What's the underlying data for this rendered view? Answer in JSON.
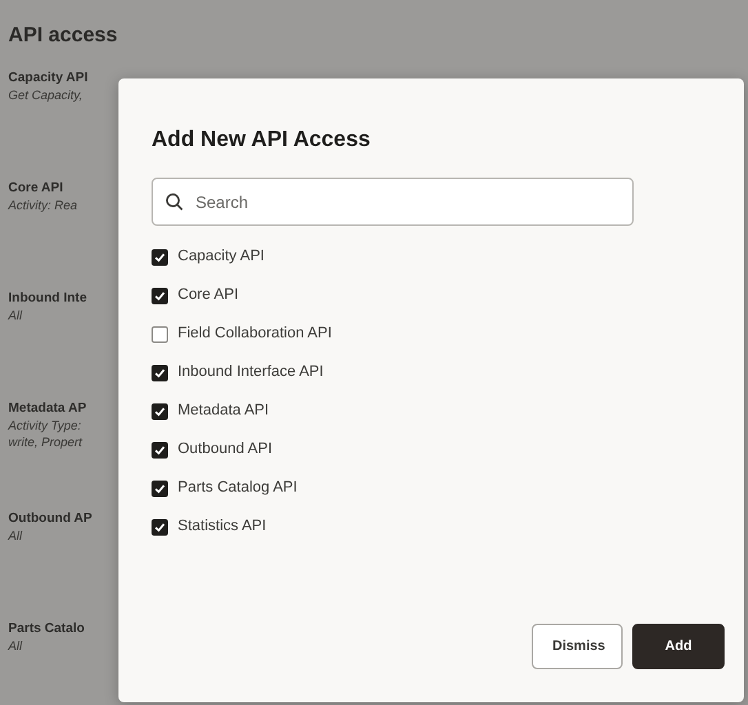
{
  "page": {
    "title": "API access",
    "items": [
      {
        "name": "Capacity API",
        "description": [
          "Get Capacity,"
        ]
      },
      {
        "name": "Core API",
        "description": [
          "Activity: Rea"
        ]
      },
      {
        "name": "Inbound Inte",
        "description": [
          "All"
        ]
      },
      {
        "name": "Metadata AP",
        "description": [
          "Activity Type:",
          "write, Propert"
        ]
      },
      {
        "name": "Outbound AP",
        "description": [
          "All"
        ]
      },
      {
        "name": "Parts Catalo",
        "description": [
          "All"
        ]
      }
    ]
  },
  "dialog": {
    "title": "Add New API Access",
    "search": {
      "placeholder": "Search"
    },
    "options": [
      {
        "label": "Capacity API",
        "checked": true
      },
      {
        "label": "Core API",
        "checked": true
      },
      {
        "label": "Field Collaboration API",
        "checked": false
      },
      {
        "label": "Inbound Interface API",
        "checked": true
      },
      {
        "label": "Metadata API",
        "checked": true
      },
      {
        "label": "Outbound API",
        "checked": true
      },
      {
        "label": "Parts Catalog API",
        "checked": true
      },
      {
        "label": "Statistics API",
        "checked": true
      }
    ],
    "buttons": [
      {
        "label": "Dismiss",
        "kind": "secondary"
      },
      {
        "label": "Add",
        "kind": "primary"
      }
    ]
  }
}
